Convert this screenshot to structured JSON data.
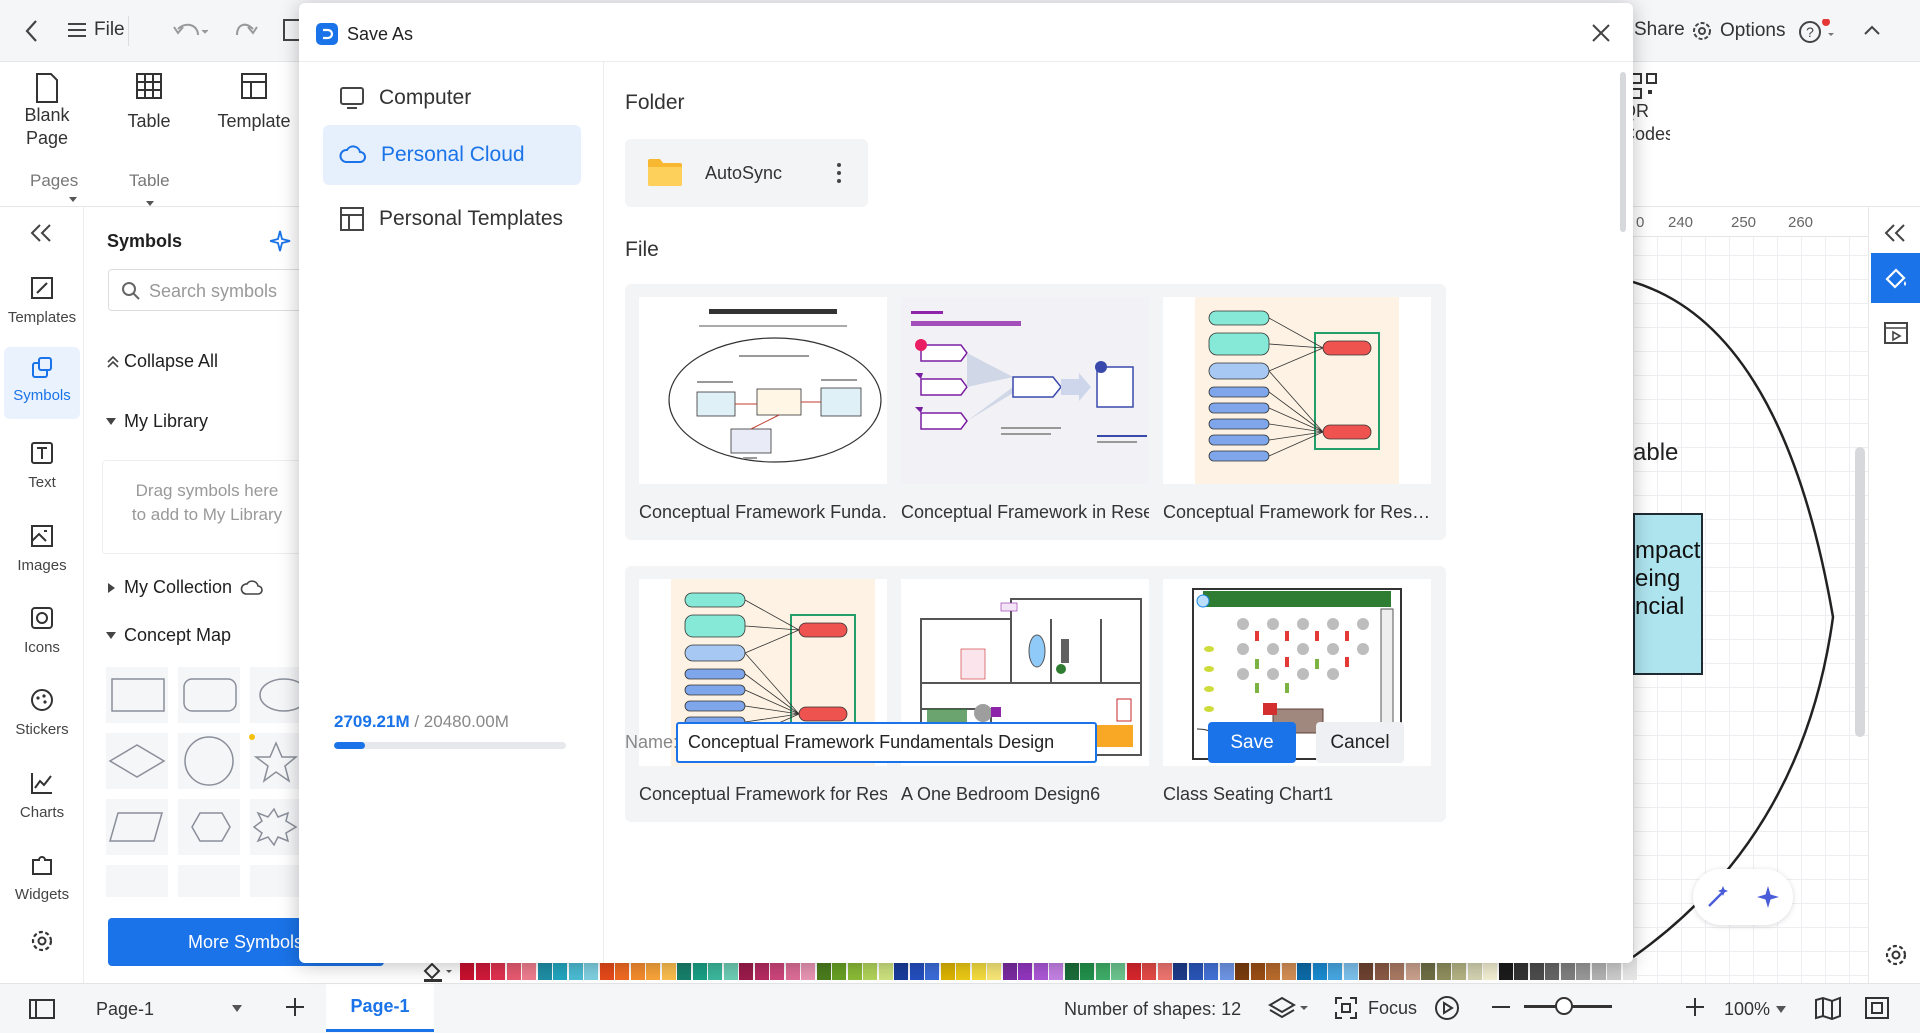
{
  "topbar": {
    "file_label": "File",
    "share_label": "Share",
    "options_label": "Options"
  },
  "ribbon": {
    "blank_page": "Blank\nPage",
    "table": "Table",
    "template": "Template",
    "qr_codes": "QR\nCodes",
    "group_pages": "Pages",
    "group_table": "Table"
  },
  "rail": [
    {
      "label": "Templates",
      "icon": "templates-icon"
    },
    {
      "label": "Symbols",
      "icon": "symbols-icon"
    },
    {
      "label": "Text",
      "icon": "text-icon"
    },
    {
      "label": "Images",
      "icon": "images-icon"
    },
    {
      "label": "Icons",
      "icon": "icons-icon"
    },
    {
      "label": "Stickers",
      "icon": "stickers-icon"
    },
    {
      "label": "Charts",
      "icon": "charts-icon"
    },
    {
      "label": "Widgets",
      "icon": "widgets-icon"
    }
  ],
  "symbols": {
    "title": "Symbols",
    "search_placeholder": "Search symbols",
    "collapse_all": "Collapse All",
    "my_library": "My Library",
    "drag_hint_1": "Drag symbols here",
    "drag_hint_2": "to add to My Library",
    "my_collection": "My Collection",
    "concept_map": "Concept Map",
    "more_symbols": "More Symbols"
  },
  "canvas": {
    "ruler_ticks": [
      "240",
      "250",
      "260"
    ],
    "ruler_first": "0",
    "text_fragment_1": "able",
    "box_text": "mpact\neing\nncial"
  },
  "dialog": {
    "title": "Save As",
    "nav": [
      {
        "label": "Computer",
        "icon": "computer-icon"
      },
      {
        "label": "Personal Cloud",
        "icon": "cloud-icon"
      },
      {
        "label": "Personal Templates",
        "icon": "templates-icon"
      }
    ],
    "storage_used": "2709.21M",
    "storage_total": " / 20480.00M",
    "storage_fraction": 0.132,
    "folder_heading": "Folder",
    "folder_name": "AutoSync",
    "file_heading": "File",
    "files": [
      "Conceptual Framework Fundamentals",
      "Conceptual Framework in Research",
      "Conceptual Framework for Research",
      "Conceptual Framework for Research",
      "A One Bedroom Design6",
      "Class Seating Chart1"
    ],
    "name_label": "Name:",
    "name_value": "Conceptual Framework Fundamentals Design",
    "save_label": "Save",
    "cancel_label": "Cancel"
  },
  "status": {
    "page_select": "Page-1",
    "page_tab": "Page-1",
    "shapes": "Number of shapes: 12",
    "focus": "Focus",
    "zoom": "100%"
  },
  "colors": {
    "accent": "#1a73e8",
    "palette": [
      "#c8102e",
      "#d11a3a",
      "#e0314f",
      "#e85a71",
      "#ee7d8f",
      "#1f8fa6",
      "#22a6bf",
      "#4cbcd4",
      "#7fd0e2",
      "#e64a19",
      "#f06a23",
      "#f58b2d",
      "#f9a43a",
      "#fbbd4d",
      "#17806b",
      "#19a085",
      "#3bb89c",
      "#6ccdb4",
      "#9c1b4b",
      "#b52a61",
      "#cc457b",
      "#dc6e97",
      "#e895b3",
      "#4b7d1e",
      "#67a024",
      "#8bbb37",
      "#b1d35a",
      "#cde27f",
      "#1a3d9c",
      "#244fbf",
      "#3c6cd9",
      "#dcb400",
      "#ebc915",
      "#f4dc3e",
      "#f8e877",
      "#7a2ba0",
      "#9236bf",
      "#ab57d6",
      "#c481e3",
      "#1a6e3a",
      "#22914c",
      "#3fae69",
      "#6cc58e",
      "#d8262d",
      "#e44a46",
      "#ef7570",
      "#1e3b8a",
      "#2a55b8",
      "#4472d6",
      "#6f95e6",
      "#7a3c0e",
      "#9a4e15",
      "#b96b2c",
      "#d48f55",
      "#0c6ba8",
      "#1a8bd1",
      "#47a7e2",
      "#7cc2ee",
      "#6e4331",
      "#8a5a45",
      "#a97a63",
      "#c9a18c",
      "#6f6f46",
      "#8f8f5e",
      "#b3b384",
      "#d3d3b0",
      "#f2eed2",
      "#1b1b1b",
      "#333333",
      "#4d4d4d",
      "#666666",
      "#808080",
      "#999999",
      "#b3b3b3",
      "#cccccc",
      "#e6e6e6"
    ]
  }
}
